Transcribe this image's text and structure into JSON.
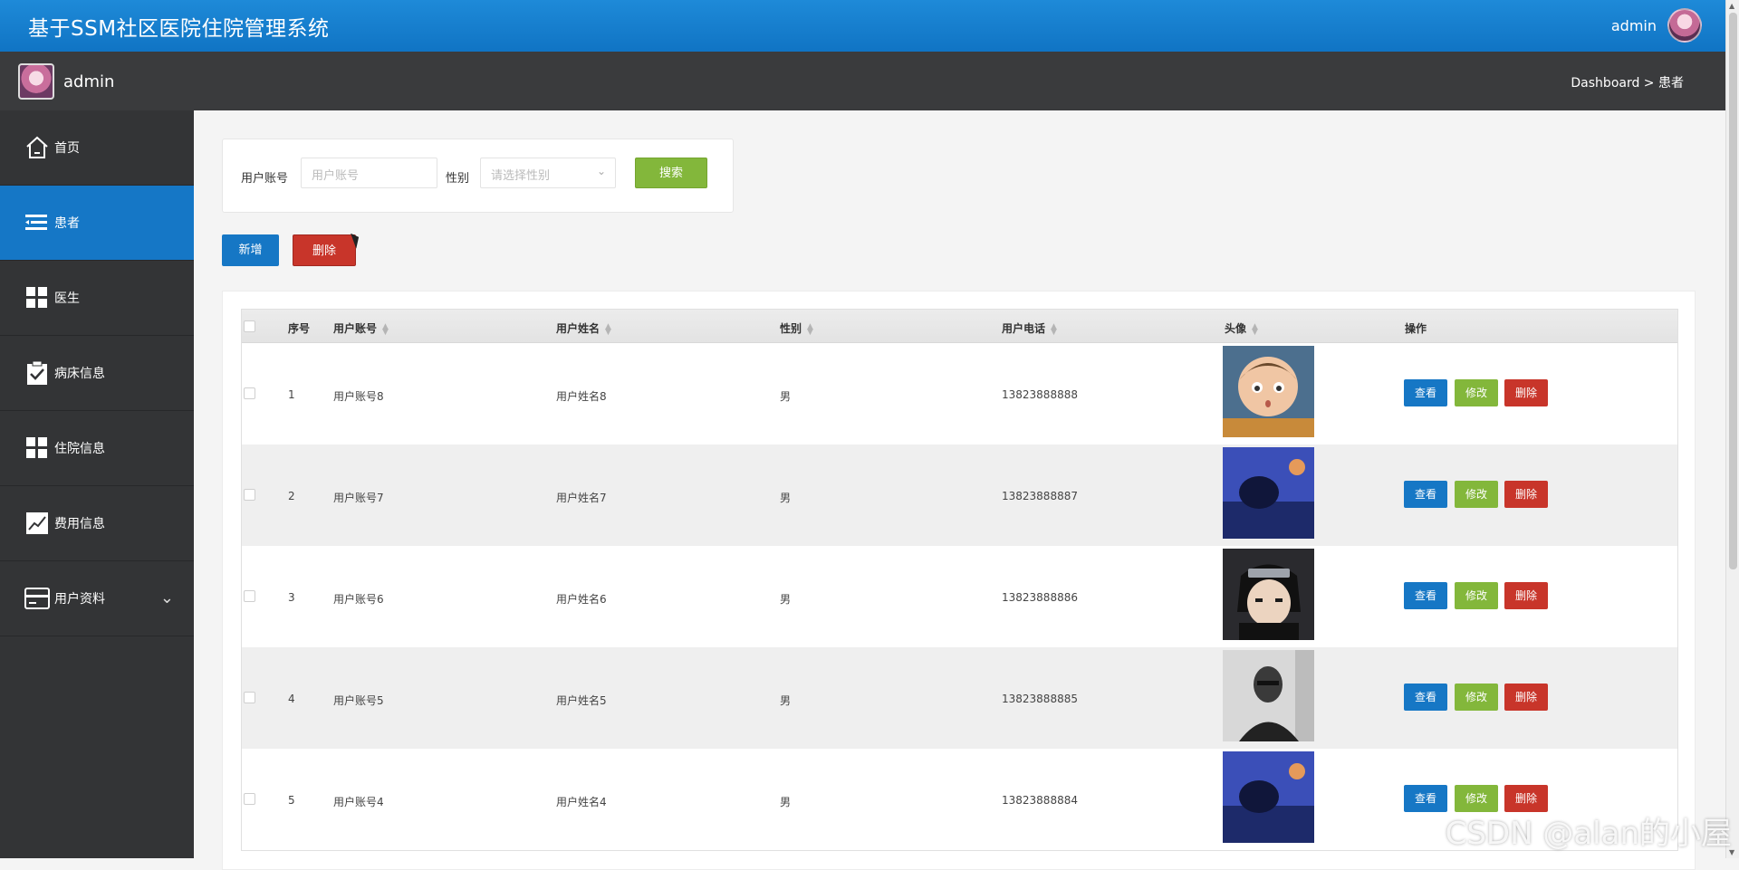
{
  "header": {
    "title": "基于SSM社区医院住院管理系统",
    "username": "admin"
  },
  "subbar": {
    "username": "admin",
    "breadcrumb": "Dashboard > 患者"
  },
  "sidebar": {
    "items": [
      {
        "label": "首页",
        "icon": "home-icon"
      },
      {
        "label": "患者",
        "icon": "list-icon",
        "active": true
      },
      {
        "label": "医生",
        "icon": "grid-icon"
      },
      {
        "label": "病床信息",
        "icon": "clipboard-check-icon"
      },
      {
        "label": "住院信息",
        "icon": "grid-icon"
      },
      {
        "label": "费用信息",
        "icon": "chart-line-icon"
      },
      {
        "label": "用户资料",
        "icon": "card-icon",
        "expandable": true
      }
    ]
  },
  "search": {
    "account_label": "用户账号",
    "account_placeholder": "用户账号",
    "gender_label": "性别",
    "gender_placeholder": "请选择性别",
    "search_button": "搜索"
  },
  "toolbar": {
    "add_label": "新增",
    "delete_label": "删除"
  },
  "table": {
    "headers": [
      "序号",
      "用户账号",
      "用户姓名",
      "性别",
      "用户电话",
      "头像",
      "操作"
    ],
    "actions": {
      "view": "查看",
      "edit": "修改",
      "delete": "删除"
    },
    "rows": [
      {
        "index": "1",
        "account": "用户账号8",
        "name": "用户姓名8",
        "gender": "男",
        "phone": "13823888888"
      },
      {
        "index": "2",
        "account": "用户账号7",
        "name": "用户姓名7",
        "gender": "男",
        "phone": "13823888887"
      },
      {
        "index": "3",
        "account": "用户账号6",
        "name": "用户姓名6",
        "gender": "男",
        "phone": "13823888886"
      },
      {
        "index": "4",
        "account": "用户账号5",
        "name": "用户姓名5",
        "gender": "男",
        "phone": "13823888885"
      },
      {
        "index": "5",
        "account": "用户账号4",
        "name": "用户姓名4",
        "gender": "男",
        "phone": "13823888884"
      }
    ]
  },
  "watermark": "CSDN @alan的小屋",
  "colors": {
    "primary": "#1677c5",
    "success": "#83b73b",
    "danger": "#c8352a",
    "sidebar": "#333436"
  }
}
